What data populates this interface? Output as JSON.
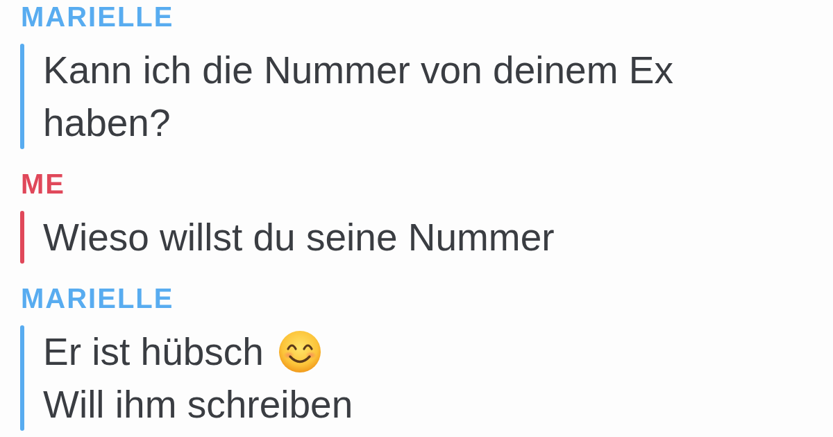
{
  "messages": [
    {
      "sender": "MARIELLE",
      "color": "#58acf0",
      "lines": [
        {
          "text": "Kann ich die Nummer von deinem Ex haben?",
          "emoji": false
        }
      ]
    },
    {
      "sender": "ME",
      "color": "#e0485a",
      "lines": [
        {
          "text": "Wieso willst du seine Nummer",
          "emoji": false
        }
      ]
    },
    {
      "sender": "MARIELLE",
      "color": "#58acf0",
      "lines": [
        {
          "text": "Er ist hübsch",
          "emoji": true
        },
        {
          "text": "Will ihm schreiben",
          "emoji": false
        }
      ]
    }
  ]
}
